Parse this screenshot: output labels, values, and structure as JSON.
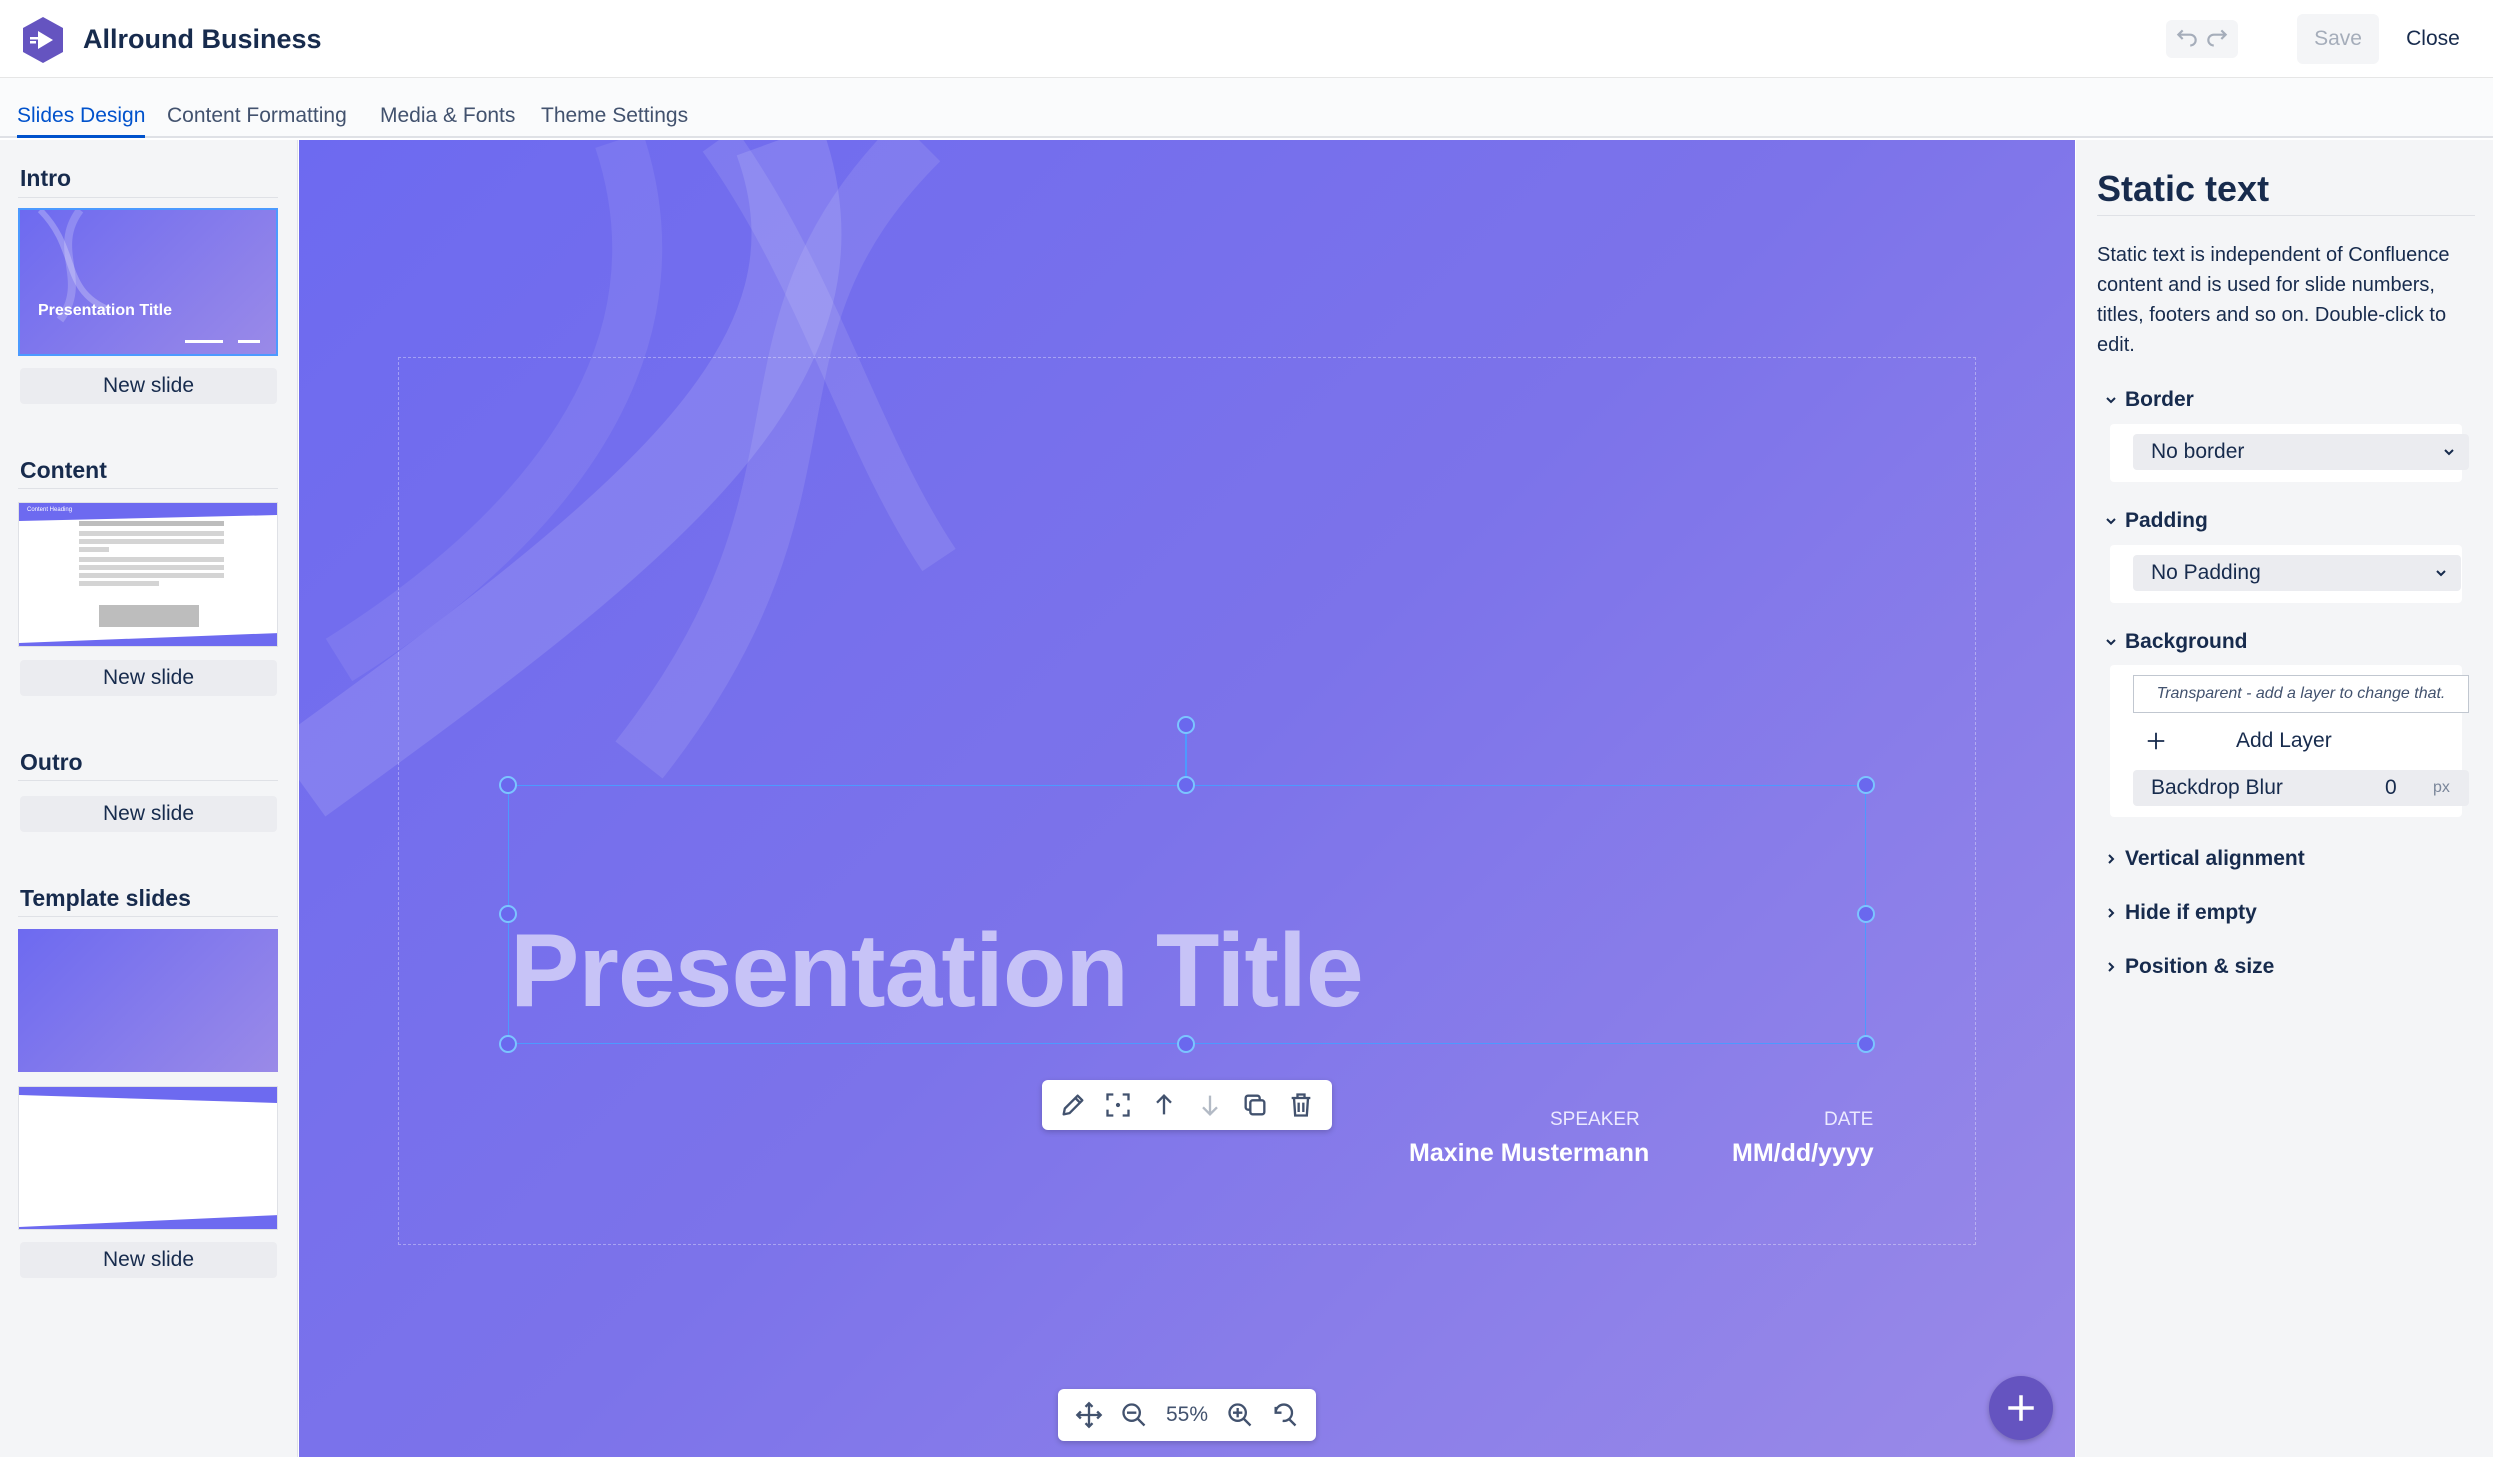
{
  "app": {
    "title": "Allround Business"
  },
  "header": {
    "save_label": "Save",
    "close_label": "Close"
  },
  "tabs": [
    {
      "label": "Slides Design",
      "active": true
    },
    {
      "label": "Content Formatting",
      "active": false
    },
    {
      "label": "Media & Fonts",
      "active": false
    },
    {
      "label": "Theme Settings",
      "active": false
    }
  ],
  "sidebar": {
    "sections": [
      {
        "title": "Intro",
        "thumb_title": "Presentation Title",
        "new_slide": "New slide"
      },
      {
        "title": "Content",
        "thumb_title": "Content Heading",
        "new_slide": "New slide"
      },
      {
        "title": "Outro",
        "new_slide": "New slide"
      },
      {
        "title": "Template slides",
        "new_slide": "New slide"
      }
    ]
  },
  "slide": {
    "title": "Presentation Title",
    "speaker_label": "SPEAKER",
    "speaker_value": "Maxine Mustermann",
    "date_label": "DATE",
    "date_value": "MM/dd/yyyy"
  },
  "zoom": {
    "value": "55%"
  },
  "panel": {
    "title": "Static text",
    "description": "Static text is independent of Confluence content and is used for slide numbers, titles, footers and so on. Double-click to edit.",
    "border": {
      "label": "Border",
      "value": "No border"
    },
    "padding": {
      "label": "Padding",
      "value": "No Padding"
    },
    "background": {
      "label": "Background",
      "transparent_note": "Transparent - add a layer to change that.",
      "add_layer": "Add Layer",
      "blur_label": "Backdrop Blur",
      "blur_value": "0",
      "blur_unit": "px"
    },
    "vertical_alignment": "Vertical alignment",
    "hide_if_empty": "Hide if empty",
    "position_size": "Position & size"
  },
  "colors": {
    "accent": "#0052cc",
    "brand": "#6554c0",
    "slide_bg": "#6d6af0"
  }
}
